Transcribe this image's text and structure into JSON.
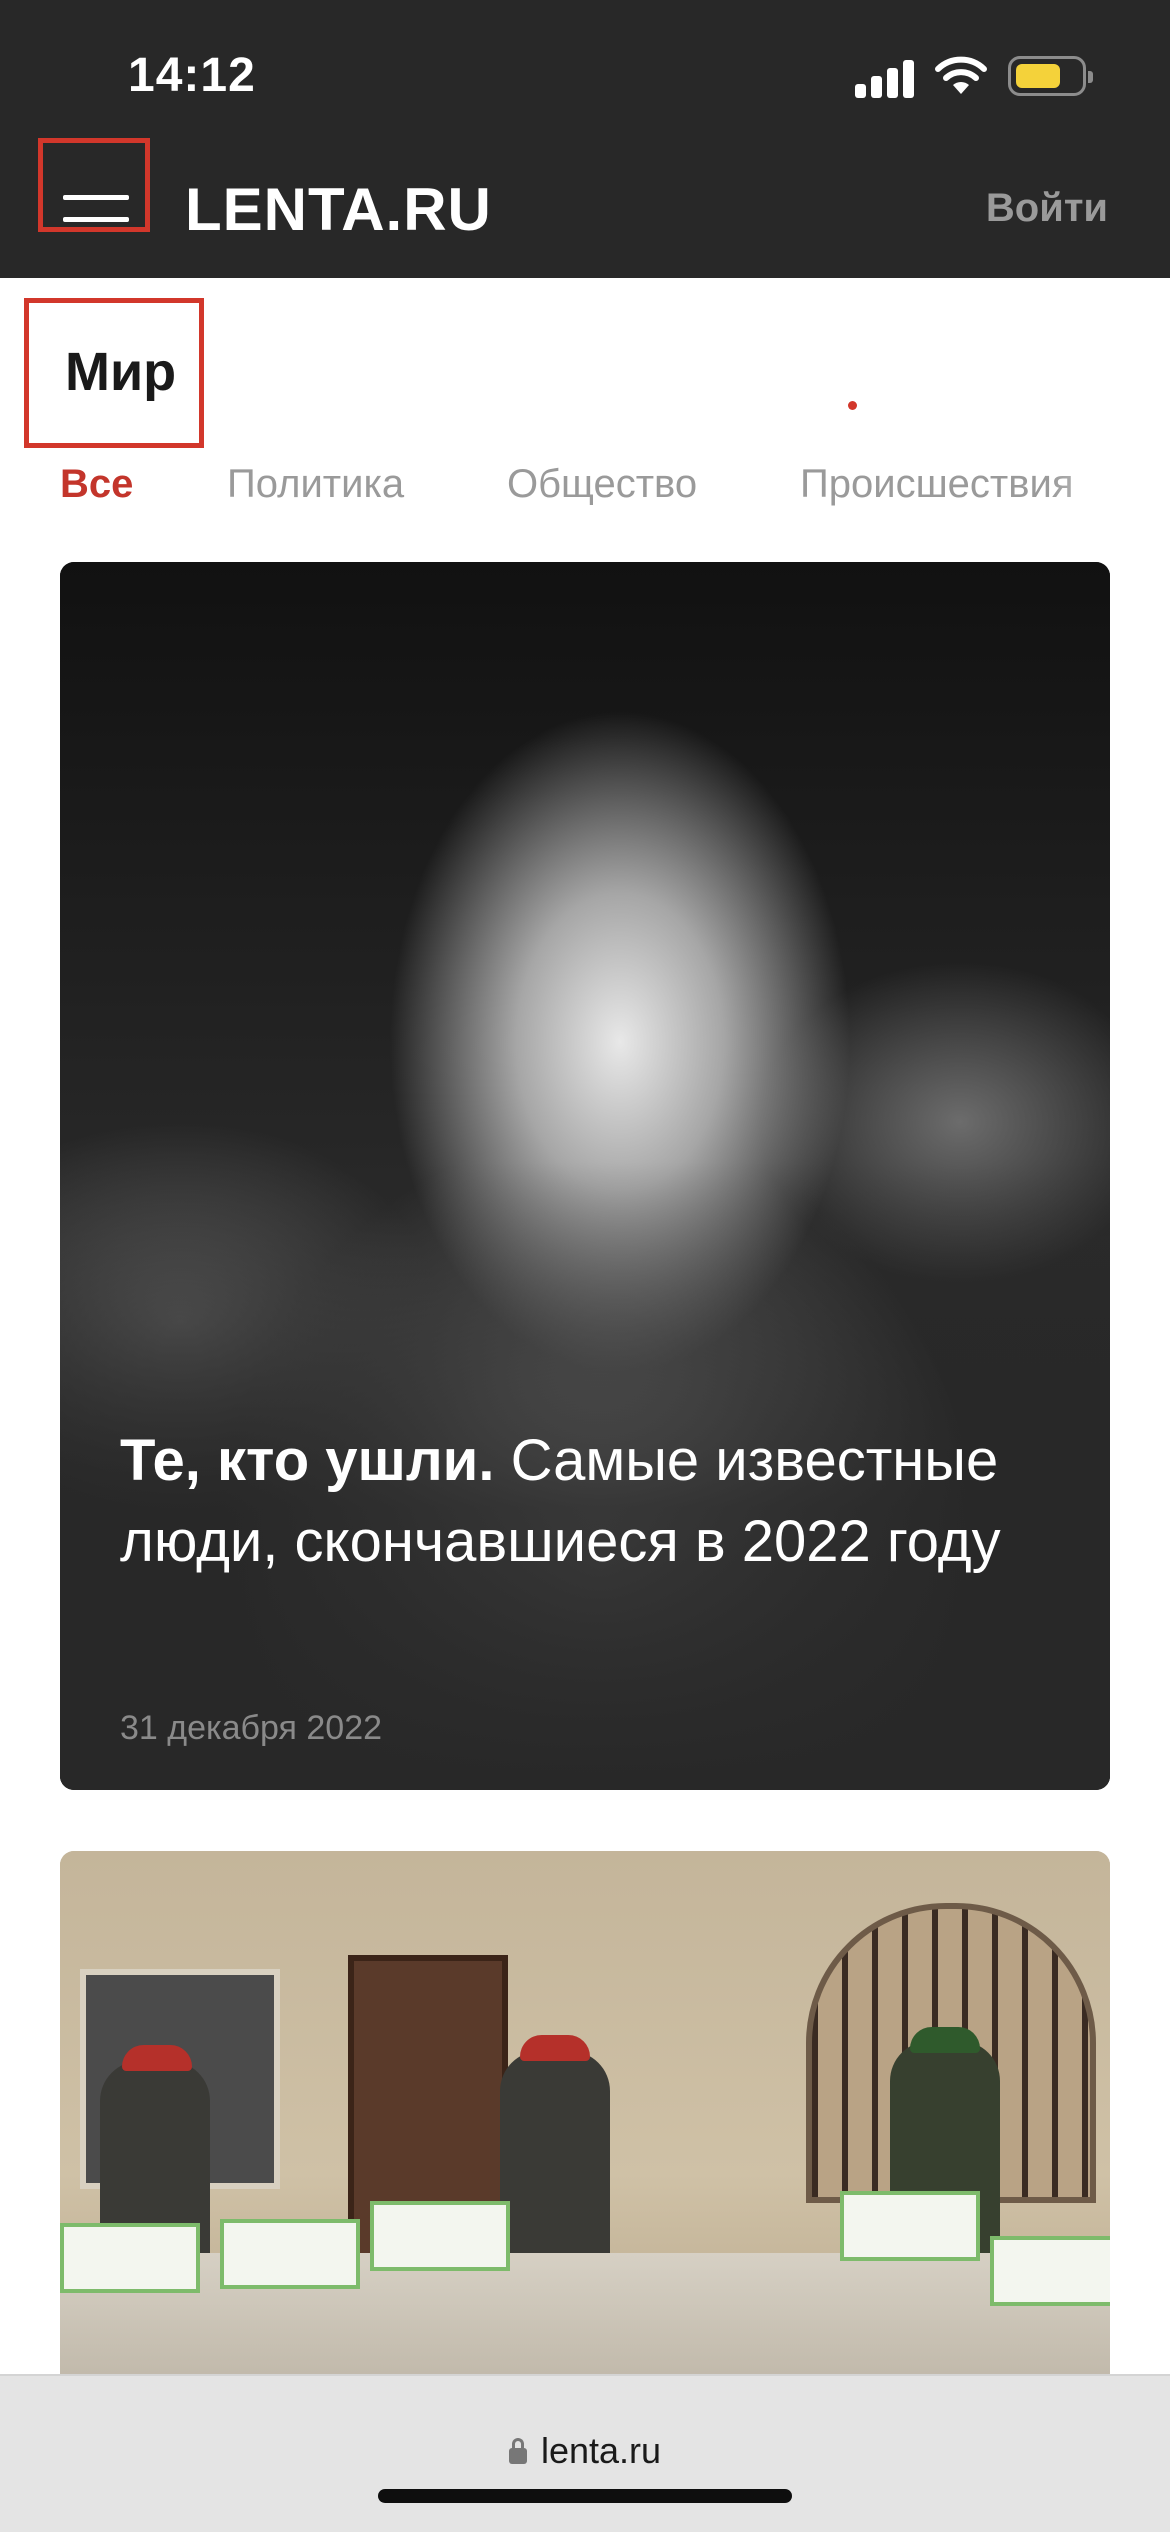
{
  "status_bar": {
    "time": "14:12",
    "icons": [
      "cellular-signal-icon",
      "wifi-icon",
      "battery-icon"
    ],
    "battery_color": "#f4d23a"
  },
  "header": {
    "logo": "LENTA.RU",
    "login_label": "Войти",
    "menu_icon": "hamburger-menu-icon",
    "background": "#282828",
    "highlight_color": "#d2372b"
  },
  "section": {
    "title": "Мир"
  },
  "tabs": [
    {
      "label": "Все",
      "active": true
    },
    {
      "label": "Политика",
      "active": false
    },
    {
      "label": "Общество",
      "active": false
    },
    {
      "label": "Происшествия",
      "active": false
    }
  ],
  "articles": [
    {
      "headline_bold": "Те, кто ушли.",
      "headline_rest": " Самые известные люди, скончавшиеся в 2022 году",
      "date": "31 декабря 2022"
    },
    {
      "headline_bold": "",
      "headline_rest": "",
      "date": ""
    }
  ],
  "browser": {
    "url": "lenta.ru"
  },
  "colors": {
    "accent": "#c3352b",
    "tab_inactive": "#9a9a9a"
  }
}
